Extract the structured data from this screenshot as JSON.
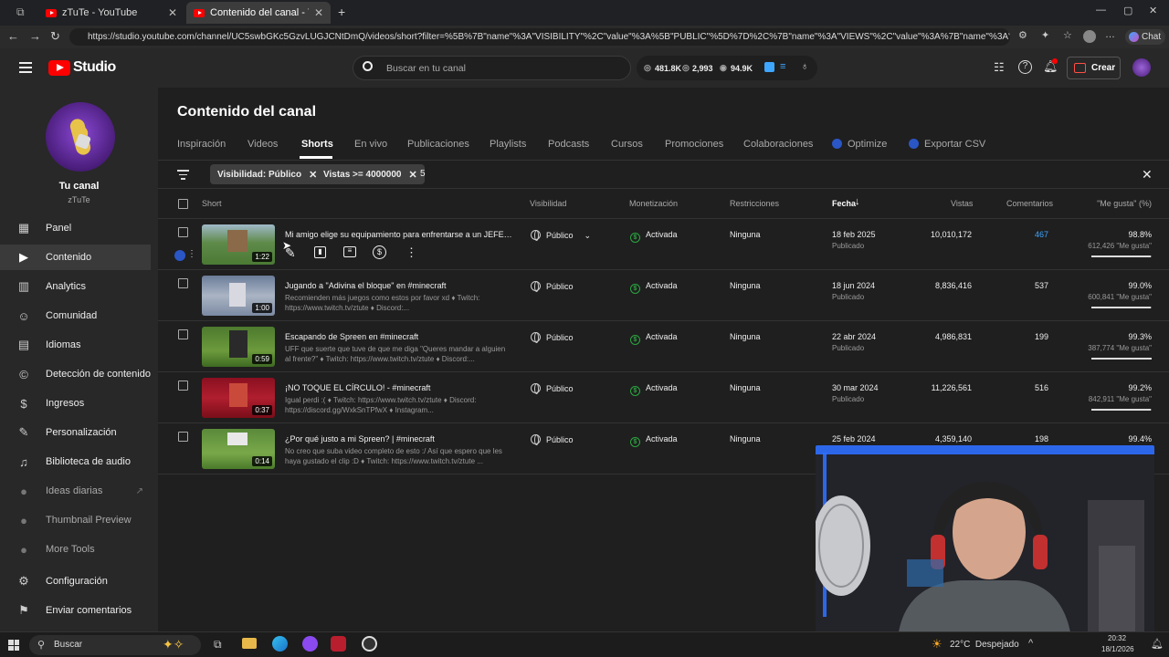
{
  "browser": {
    "tabs": [
      {
        "label": "zTuTe - YouTube"
      },
      {
        "label": "Contenido del canal - YouTube St"
      }
    ],
    "url": "https://studio.youtube.com/channel/UC5swbGKc5GzvLUGJCNtDmQ/videos/short?filter=%5B%7B\"name\"%3A\"VISIBILITY\"%2C\"value\"%3A%5B\"PUBLIC\"%5D%7D%2C%7B\"name\"%3A\"VIEWS\"%2C\"value\"%3A%7B\"name\"%3A\"GREATER_EQUAL\"%2...",
    "chat_label": "Chat"
  },
  "header": {
    "logo_text": "Studio",
    "search_placeholder": "Buscar en tu canal",
    "stats": {
      "subs": "481.8K",
      "videos": "2,993",
      "views": "94.9K"
    },
    "create_label": "Crear"
  },
  "sidebar": {
    "channel_title": "Tu canal",
    "channel_name": "zTuTe",
    "items": [
      {
        "label": "Panel",
        "icon": "dashboard-icon"
      },
      {
        "label": "Contenido",
        "icon": "content-icon",
        "active": true
      },
      {
        "label": "Analytics",
        "icon": "analytics-icon"
      },
      {
        "label": "Comunidad",
        "icon": "community-icon"
      },
      {
        "label": "Idiomas",
        "icon": "subtitles-icon"
      },
      {
        "label": "Detección de contenido",
        "icon": "copyright-icon"
      },
      {
        "label": "Ingresos",
        "icon": "dollar-icon"
      },
      {
        "label": "Personalización",
        "icon": "brush-icon"
      },
      {
        "label": "Biblioteca de audio",
        "icon": "audio-library-icon"
      },
      {
        "label": "Ideas diarias",
        "icon": "extension-icon",
        "dim": true
      },
      {
        "label": "Thumbnail Preview",
        "icon": "extension-icon",
        "dim": true
      },
      {
        "label": "More Tools",
        "icon": "extension-icon",
        "dim": true
      },
      {
        "label": "Configuración",
        "icon": "gear-icon"
      },
      {
        "label": "Enviar comentarios",
        "icon": "feedback-icon"
      }
    ]
  },
  "main": {
    "page_title": "Contenido del canal",
    "tabs": [
      "Inspiración",
      "Videos",
      "Shorts",
      "En vivo",
      "Publicaciones",
      "Playlists",
      "Podcasts",
      "Cursos",
      "Promociones",
      "Colaboraciones",
      "Optimize",
      "Exportar CSV"
    ],
    "active_tab": "Shorts",
    "filters": {
      "chip1": "Visibilidad: Público",
      "chip2": "Vistas >= 4000000",
      "typed": "5"
    },
    "columns": {
      "short": "Short",
      "visibility": "Visibilidad",
      "monetization": "Monetización",
      "restrictions": "Restricciones",
      "date": "Fecha",
      "views": "Vistas",
      "comments": "Comentarios",
      "likes": "\"Me gusta\" (%)"
    },
    "rows": [
      {
        "title": "Mi amigo elige su equipamiento para enfrentarse a un JEFE F...",
        "desc": "",
        "duration": "1:22",
        "visibility": "Público",
        "monetization": "Activada",
        "restrictions": "Ninguna",
        "date": "18 feb 2025",
        "status": "Publicado",
        "views": "10,010,172",
        "comments": "467",
        "like_pct": "98.8%",
        "like_count": "612,426 \"Me gusta\"",
        "like_frac": 0.988
      },
      {
        "title": "Jugando a \"Adivina el bloque\" en #minecraft",
        "desc": "Recomienden más juegos como estos por favor xd ♦ Twitch: https://www.twitch.tv/ztute ♦ Discord:...",
        "duration": "1:00",
        "visibility": "Público",
        "monetization": "Activada",
        "restrictions": "Ninguna",
        "date": "18 jun 2024",
        "status": "Publicado",
        "views": "8,836,416",
        "comments": "537",
        "like_pct": "99.0%",
        "like_count": "600,841 \"Me gusta\"",
        "like_frac": 0.99
      },
      {
        "title": "Escapando de Spreen en #minecraft",
        "desc": "UFF que suerte que tuve de que me diga \"Queres mandar a alguien al frente?\" ♦ Twitch: https://www.twitch.tv/ztute ♦ Discord:...",
        "duration": "0:59",
        "visibility": "Público",
        "monetization": "Activada",
        "restrictions": "Ninguna",
        "date": "22 abr 2024",
        "status": "Publicado",
        "views": "4,986,831",
        "comments": "199",
        "like_pct": "99.3%",
        "like_count": "387,774 \"Me gusta\"",
        "like_frac": 0.993
      },
      {
        "title": "¡NO TOQUE EL CÍRCULO! - #minecraft",
        "desc": "Igual perdi :( ♦ Twitch: https://www.twitch.tv/ztute ♦ Discord: https://discord.gg/WxkSnTPfwX ♦ Instagram...",
        "duration": "0:37",
        "visibility": "Público",
        "monetization": "Activada",
        "restrictions": "Ninguna",
        "date": "30 mar 2024",
        "status": "Publicado",
        "views": "11,226,561",
        "comments": "516",
        "like_pct": "99.2%",
        "like_count": "842,911 \"Me gusta\"",
        "like_frac": 0.992
      },
      {
        "title": "¿Por qué justo a mi Spreen? | #minecraft",
        "desc": "No creo que suba video completo de esto :/ Así que espero que les haya gustado el clip :D ♦ Twitch: https://www.twitch.tv/ztute ...",
        "duration": "0:14",
        "visibility": "Público",
        "monetization": "Activada",
        "restrictions": "Ninguna",
        "date": "25 feb 2024",
        "status": "",
        "views": "4,359,140",
        "comments": "198",
        "like_pct": "99.4%",
        "like_count": "",
        "like_frac": 0.994
      }
    ]
  },
  "taskbar": {
    "search_placeholder": "Buscar",
    "weather": "22°C  Despejado",
    "time": "20:32",
    "date": "18/1/2026"
  },
  "colors": {
    "accent_blue": "#3ea6ff",
    "monetized_green": "#2ba640",
    "yt_red": "#ff0000"
  }
}
